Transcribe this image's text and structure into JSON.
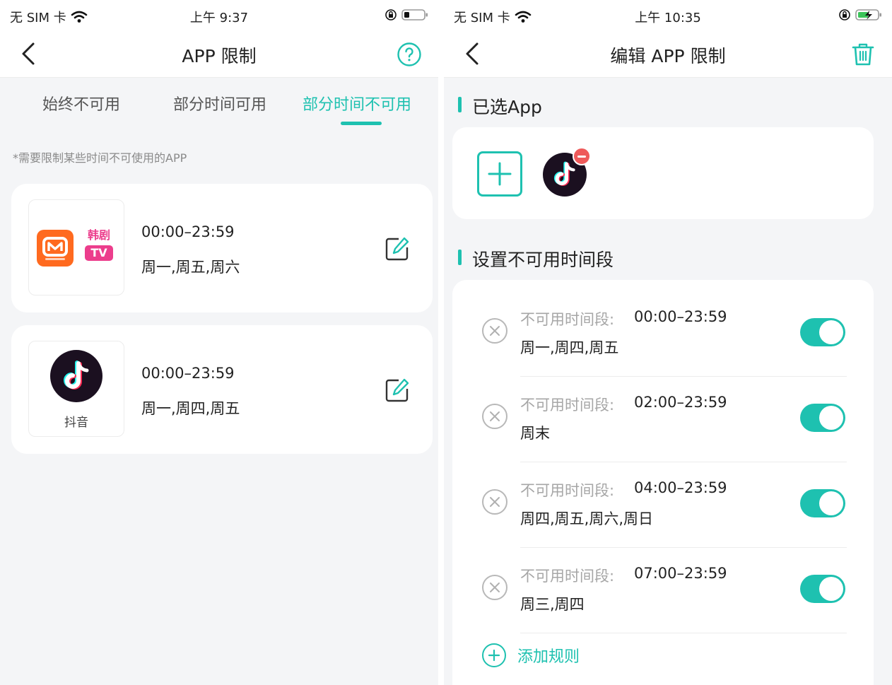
{
  "colors": {
    "accent": "#1ec1b0",
    "danger": "#ee5a5a",
    "background": "#f4f5f7"
  },
  "left": {
    "status": {
      "carrier": "无 SIM 卡",
      "time": "上午 9:37"
    },
    "nav": {
      "title": "APP 限制",
      "back_icon": "chevron-left-icon",
      "action_icon": "help-circle-icon"
    },
    "tabs": [
      {
        "label": "始终不可用",
        "active": false
      },
      {
        "label": "部分时间可用",
        "active": false
      },
      {
        "label": "部分时间不可用",
        "active": true
      }
    ],
    "hint": "*需要限制某些时间不可使用的APP",
    "cards": [
      {
        "apps": [
          {
            "icon": "mangotv-icon",
            "name": ""
          },
          {
            "icon": "hanju-tv-icon",
            "name": ""
          }
        ],
        "logo_text": "韩剧",
        "logo_badge": "TV",
        "time": "00:00–23:59",
        "days": "周一,周五,周六"
      },
      {
        "apps": [
          {
            "icon": "douyin-icon",
            "name": "抖音"
          }
        ],
        "time": "00:00–23:59",
        "days": "周一,周四,周五"
      }
    ]
  },
  "right": {
    "status": {
      "carrier": "无 SIM 卡",
      "time": "上午 10:35"
    },
    "nav": {
      "title": "编辑 APP 限制",
      "back_icon": "chevron-left-icon",
      "action_icon": "trash-icon"
    },
    "selected_section_title": "已选App",
    "selected_apps": [
      {
        "icon": "douyin-icon"
      }
    ],
    "rules_section_title": "设置不可用时间段",
    "rule_label": "不可用时间段:",
    "rules": [
      {
        "time": "00:00–23:59",
        "days": "周一,周四,周五",
        "enabled": true
      },
      {
        "time": "02:00–23:59",
        "days": "周末",
        "enabled": true
      },
      {
        "time": "04:00–23:59",
        "days": "周四,周五,周六,周日",
        "enabled": true
      },
      {
        "time": "07:00–23:59",
        "days": "周三,周四",
        "enabled": true
      }
    ],
    "add_rule_label": "添加规则"
  }
}
